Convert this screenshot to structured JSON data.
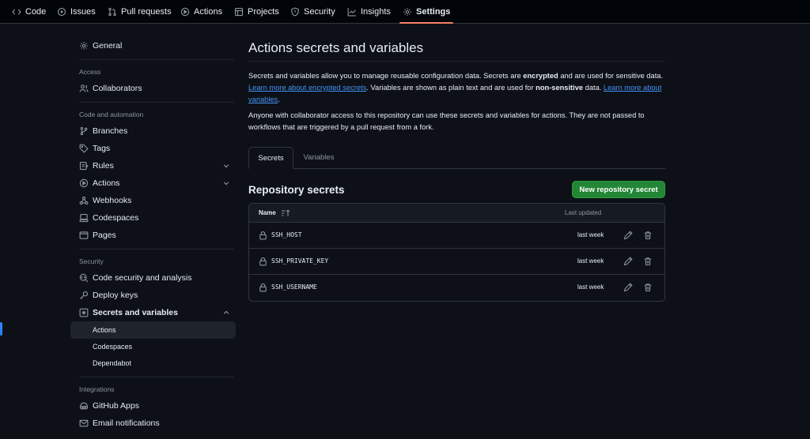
{
  "topnav": {
    "tabs": [
      {
        "label": "Code",
        "icon": "code-icon"
      },
      {
        "label": "Issues",
        "icon": "issue-icon"
      },
      {
        "label": "Pull requests",
        "icon": "pull-request-icon"
      },
      {
        "label": "Actions",
        "icon": "play-icon"
      },
      {
        "label": "Projects",
        "icon": "table-icon"
      },
      {
        "label": "Security",
        "icon": "shield-icon"
      },
      {
        "label": "Insights",
        "icon": "graph-icon"
      },
      {
        "label": "Settings",
        "icon": "gear-icon",
        "active": true
      }
    ]
  },
  "sidebar": {
    "general": "General",
    "access_heading": "Access",
    "collaborators": "Collaborators",
    "code_heading": "Code and automation",
    "branches": "Branches",
    "tags": "Tags",
    "rules": "Rules",
    "actions": "Actions",
    "webhooks": "Webhooks",
    "codespaces": "Codespaces",
    "pages": "Pages",
    "security_heading": "Security",
    "code_security": "Code security and analysis",
    "deploy_keys": "Deploy keys",
    "secrets_variables": "Secrets and variables",
    "sub_actions": "Actions",
    "sub_codespaces": "Codespaces",
    "sub_dependabot": "Dependabot",
    "integrations_heading": "Integrations",
    "github_apps": "GitHub Apps",
    "email_notifications": "Email notifications"
  },
  "main": {
    "title": "Actions secrets and variables",
    "intro": {
      "t1": "Secrets and variables allow you to manage reusable configuration data. Secrets are ",
      "b1": "encrypted",
      "t2": " and are used for sensitive data. ",
      "link1": "Learn more about encrypted secrets",
      "t3": ". Variables are shown as plain text and are used for ",
      "b2": "non-sensitive",
      "t4": " data. ",
      "link2": "Learn more about variables",
      "t5": "."
    },
    "notice": "Anyone with collaborator access to this repository can use these secrets and variables for actions. They are not passed to workflows that are triggered by a pull request from a fork.",
    "tabs": {
      "secrets": "Secrets",
      "variables": "Variables"
    },
    "section_title": "Repository secrets",
    "new_button": "New repository secret",
    "table": {
      "col_name": "Name",
      "col_updated": "Last updated",
      "rows": [
        {
          "name": "SSH_HOST",
          "updated": "last week"
        },
        {
          "name": "SSH_PRIVATE_KEY",
          "updated": "last week"
        },
        {
          "name": "SSH_USERNAME",
          "updated": "last week"
        }
      ]
    }
  },
  "colors": {
    "accent": "#2f81f7",
    "button": "#238636",
    "active_underline": "#f78166",
    "link": "#4493f8"
  }
}
